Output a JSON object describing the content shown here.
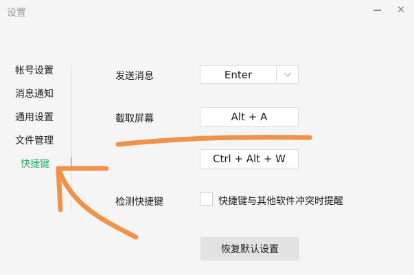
{
  "window": {
    "title": "设置",
    "minimize_icon": "minimize-icon",
    "close_icon": "close-icon",
    "close_glyph": "✕"
  },
  "sidebar": {
    "items": [
      {
        "label": "帐号设置"
      },
      {
        "label": "消息通知"
      },
      {
        "label": "通用设置"
      },
      {
        "label": "文件管理"
      },
      {
        "label": "快捷键",
        "active": true
      }
    ],
    "active_color": "#2aae67"
  },
  "shortcuts": {
    "send": {
      "label": "发送消息",
      "value": "Enter",
      "arrow_icon": "chevron-down-icon"
    },
    "screenshot": {
      "label": "截取屏幕",
      "value": "Alt + A"
    },
    "hidden_row": {
      "value": "Ctrl + Alt + W"
    },
    "detect": {
      "label": "检测快捷键",
      "checkbox_label": "快捷键与其他软件冲突时提醒",
      "checked": false
    },
    "reset_label": "恢复默认设置"
  },
  "annotation": {
    "color": "#f0924a",
    "underline": "orange-underline-mark",
    "arrow": "orange-arrow-mark"
  }
}
